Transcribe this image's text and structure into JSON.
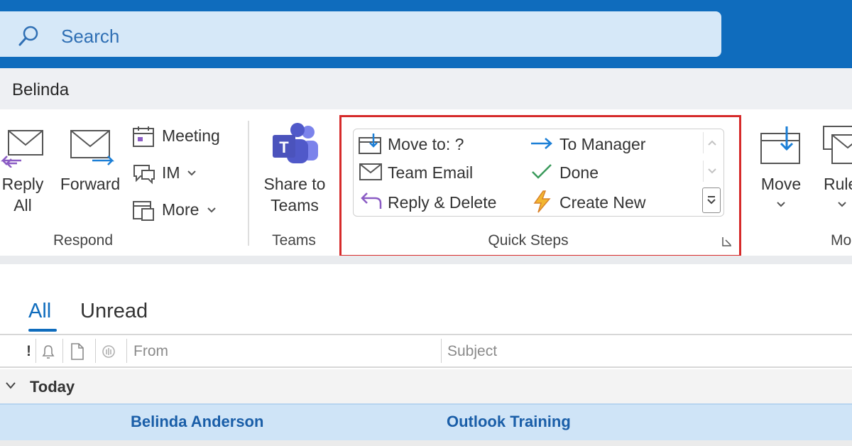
{
  "search": {
    "placeholder": "Search"
  },
  "account": {
    "name": "Belinda"
  },
  "ribbon": {
    "respond": {
      "reply_all_line1": "Reply",
      "reply_all_line2": "All",
      "forward": "Forward",
      "meeting": "Meeting",
      "im": "IM",
      "more": "More",
      "group_label": "Respond"
    },
    "teams": {
      "share_line1": "Share to",
      "share_line2": "Teams",
      "group_label": "Teams"
    },
    "quick_steps": {
      "items": [
        "Move to: ?",
        "Team Email",
        "Reply & Delete",
        "To Manager",
        "Done",
        "Create New"
      ],
      "group_label": "Quick Steps"
    },
    "move": {
      "label": "Move",
      "dropdown": "⌄"
    },
    "rules": {
      "label": "Rule",
      "group_partial": "Mo"
    }
  },
  "mail": {
    "tabs": [
      "All",
      "Unread"
    ],
    "columns": {
      "importance": "!",
      "from": "From",
      "subject": "Subject"
    },
    "group": "Today",
    "rows": [
      {
        "from": "Belinda Anderson",
        "subject": "Outlook Training"
      }
    ]
  },
  "colors": {
    "titlebar": "#0f6cbd",
    "search_bg": "#d6e8f8",
    "highlight_border": "#d62a2a",
    "selected_row": "#cfe4f7",
    "accent": "#0f6cbd"
  },
  "icons": [
    "search-icon",
    "reply-all-icon",
    "forward-icon",
    "meeting-icon",
    "im-icon",
    "more-icon",
    "teams-icon",
    "move-to-icon",
    "team-email-icon",
    "reply-delete-icon",
    "to-manager-icon",
    "done-icon",
    "create-new-icon",
    "move-icon",
    "rules-icon",
    "flag-icon",
    "reminder-icon",
    "document-icon",
    "attachment-icon",
    "chevron-down-icon"
  ]
}
